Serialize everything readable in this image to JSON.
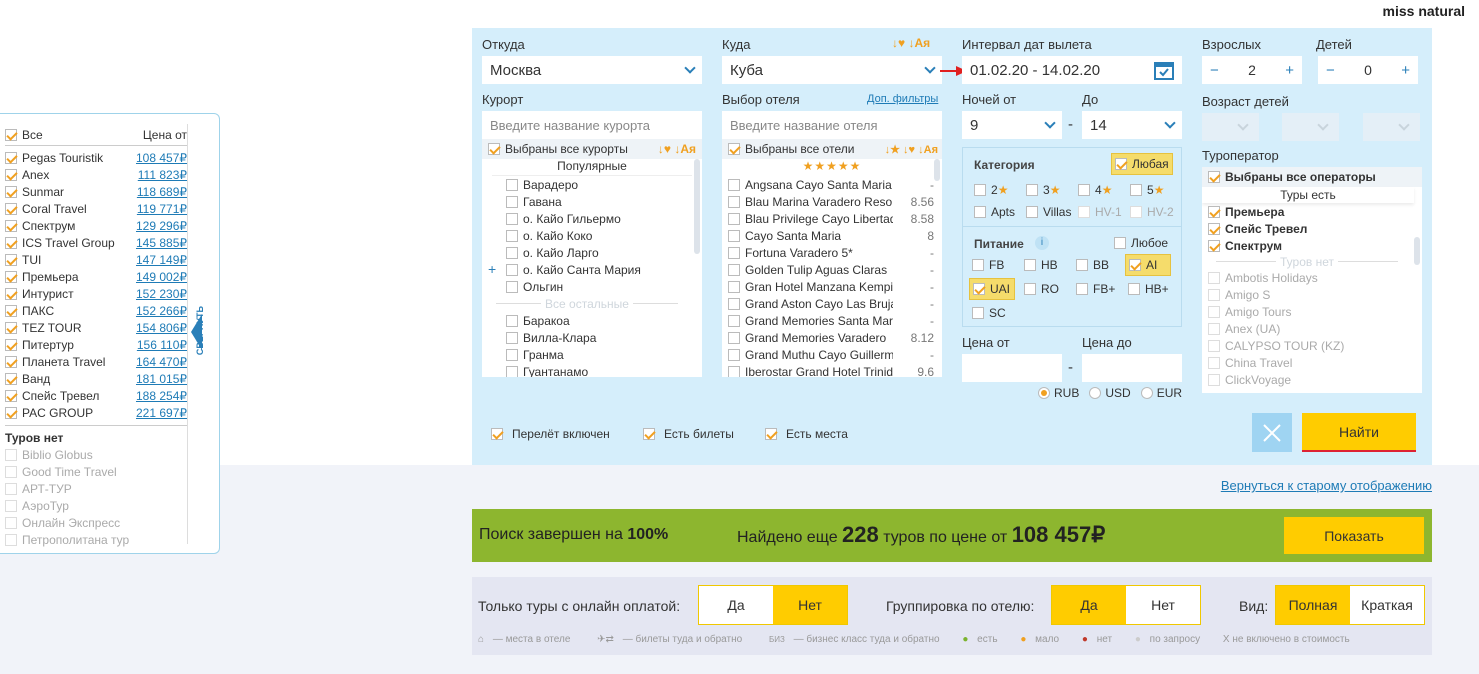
{
  "brand": "miss natural",
  "left_panel": {
    "all_label": "Все",
    "price_header": "Цена от",
    "operators": [
      {
        "name": "Pegas Touristik",
        "price": "108 457₽"
      },
      {
        "name": "Anex",
        "price": "111 823₽"
      },
      {
        "name": "Sunmar",
        "price": "118 689₽"
      },
      {
        "name": "Coral Travel",
        "price": "119 771₽"
      },
      {
        "name": "Спектрум",
        "price": "129 296₽"
      },
      {
        "name": "ICS Travel Group",
        "price": "145 885₽"
      },
      {
        "name": "TUI",
        "price": "147 149₽"
      },
      {
        "name": "Премьера",
        "price": "149 002₽"
      },
      {
        "name": "Интурист",
        "price": "152 230₽"
      },
      {
        "name": "ПАКС",
        "price": "152 266₽"
      },
      {
        "name": "TEZ TOUR",
        "price": "154 806₽"
      },
      {
        "name": "Питертур",
        "price": "156 110₽"
      },
      {
        "name": "Планета Travel",
        "price": "164 470₽"
      },
      {
        "name": "Ванд",
        "price": "181 015₽"
      },
      {
        "name": "Спейс Тревел",
        "price": "188 254₽"
      },
      {
        "name": "PAC GROUP",
        "price": "221 697₽"
      }
    ],
    "no_tours_label": "Туров нет",
    "no_tours": [
      "Biblio Globus",
      "Good Time Travel",
      "АРТ-ТУР",
      "АэроТур",
      "Онлайн Экспресс",
      "Петрополитана тур"
    ],
    "collapse_label": "СВЕРНУТЬ"
  },
  "search": {
    "from_label": "Откуда",
    "from_value": "Москва",
    "to_label": "Куда",
    "to_value": "Куба",
    "sort_icons": "↓♥ ↓Ая",
    "dates_label": "Интервал дат вылета",
    "dates_value": "01.02.20 - 14.02.20",
    "adults_label": "Взрослых",
    "adults": "2",
    "children_label": "Детей",
    "children": "0",
    "resort_label": "Курорт",
    "resort_placeholder": "Введите название курорта",
    "resort_all": "Выбраны все курорты",
    "popular_label": "Популярные",
    "popular_resorts": [
      "Варадеро",
      "Гавана",
      "о. Кайо Гильермо",
      "о. Кайо Коко",
      "о. Кайо Ларго",
      "о. Кайо Санта Мария",
      "Ольгин"
    ],
    "other_label": "Все остальные",
    "other_resorts": [
      "Баракоа",
      "Вилла-Клара",
      "Гранма",
      "Гуантанамо"
    ],
    "hotel_label": "Выбор отеля",
    "extra_filters": "Доп. фильтры",
    "hotel_placeholder": "Введите название отеля",
    "hotel_all": "Выбраны все отели",
    "hotel_stars": "★★★★★",
    "hotels": [
      {
        "name": "Angsana Cayo Santa Maria",
        "score": "-"
      },
      {
        "name": "Blau Marina Varadero Resort",
        "score": "8.56"
      },
      {
        "name": "Blau Privilege Cayo Libertad",
        "score": "8.58"
      },
      {
        "name": "Cayo Santa Maria",
        "score": "8"
      },
      {
        "name": "Fortuna Varadero 5*",
        "score": "-"
      },
      {
        "name": "Golden Tulip Aguas Claras",
        "score": "-"
      },
      {
        "name": "Gran Hotel Manzana Kempinski",
        "score": "-"
      },
      {
        "name": "Grand Aston Cayo Las Brujas",
        "score": "-"
      },
      {
        "name": "Grand Memories Santa Maria",
        "score": "-"
      },
      {
        "name": "Grand Memories Varadero",
        "score": "8.12"
      },
      {
        "name": "Grand Muthu Cayo Guillermo",
        "score": "-"
      },
      {
        "name": "Iberostar Grand Hotel Trinidad",
        "score": "9.6"
      }
    ],
    "nights_from_label": "Ночей от",
    "nights_from": "9",
    "nights_to_label": "До",
    "nights_to": "14",
    "children_age_label": "Возраст детей",
    "category_label": "Категория",
    "category_any": "Любая",
    "categories": [
      "2",
      "3",
      "4",
      "5",
      "Apts",
      "Villas",
      "HV-1",
      "HV-2"
    ],
    "meal_label": "Питание",
    "meal_any": "Любое",
    "meals": [
      {
        "name": "FB",
        "on": false
      },
      {
        "name": "HB",
        "on": false
      },
      {
        "name": "BB",
        "on": false
      },
      {
        "name": "AI",
        "on": true
      },
      {
        "name": "UAI",
        "on": true
      },
      {
        "name": "RO",
        "on": false
      },
      {
        "name": "FB+",
        "on": false
      },
      {
        "name": "HB+",
        "on": false
      },
      {
        "name": "SC",
        "on": false
      }
    ],
    "price_from_label": "Цена от",
    "price_to_label": "Цена до",
    "currencies": [
      "RUB",
      "USD",
      "EUR"
    ],
    "currency_selected": "RUB",
    "operator_label": "Туроператор",
    "operator_all": "Выбраны все операторы",
    "tours_yes": "Туры есть",
    "operators_partial": "Премьера",
    "operators_on": [
      "Спейс Тревел",
      "Спектрум"
    ],
    "tours_no": "Туров нет",
    "operators_off": [
      "Ambotis Holidays",
      "Amigo S",
      "Amigo Tours",
      "Anex (UA)",
      "CALYPSO TOUR (KZ)",
      "China Travel",
      "ClickVoyage"
    ],
    "flight_included": "Перелёт включен",
    "tickets": "Есть билеты",
    "seats": "Есть места",
    "find_button": "Найти"
  },
  "old_view_link": "Вернуться к старому отображению",
  "result": {
    "done_prefix": "Поиск завершен на",
    "done_pct": "100%",
    "found_prefix": "Найдено еще",
    "count": "228",
    "found_mid": "туров по цене от",
    "price": "108 457₽",
    "show_button": "Показать"
  },
  "filters": {
    "online_label": "Только туры с онлайн оплатой:",
    "yes": "Да",
    "no": "Нет",
    "group_label": "Группировка по отелю:",
    "view_label": "Вид:",
    "full": "Полная",
    "short": "Краткая"
  },
  "legend": {
    "seats": "— места в отеле",
    "tickets": "— билеты туда и обратно",
    "business": "— бизнес класс туда и обратно",
    "biz": "БИЗ",
    "yes": "есть",
    "few": "мало",
    "none": "нет",
    "request": "по запросу",
    "excluded": "X не включено в стоимость"
  },
  "colors": {
    "panel": "#d5eefb",
    "accent": "#ffcc00",
    "green": "#8db62f",
    "link": "#1e7bb6",
    "check": "#f0a020"
  }
}
